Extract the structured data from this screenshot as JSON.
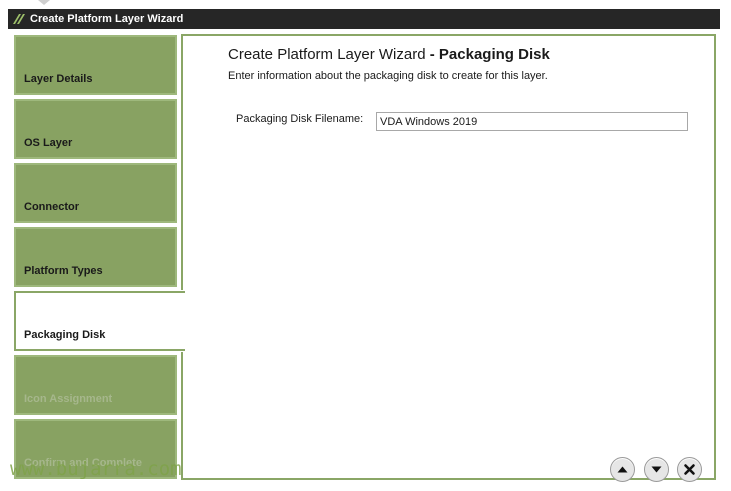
{
  "window": {
    "title": "Create Platform Layer Wizard"
  },
  "sidebar": {
    "items": [
      {
        "label": "Layer Details",
        "state": "enabled"
      },
      {
        "label": "OS Layer",
        "state": "enabled"
      },
      {
        "label": "Connector",
        "state": "enabled"
      },
      {
        "label": "Platform Types",
        "state": "enabled"
      },
      {
        "label": "Packaging Disk",
        "state": "active"
      },
      {
        "label": "Icon Assignment",
        "state": "disabled"
      },
      {
        "label": "Confirm and Complete",
        "state": "disabled"
      }
    ]
  },
  "main": {
    "heading_prefix": "Create Platform Layer Wizard",
    "heading_step": "- Packaging Disk",
    "subtitle": "Enter information about the packaging disk to create for this layer.",
    "field": {
      "label": "Packaging Disk Filename:",
      "value": "VDA Windows 2019"
    }
  },
  "nav": {
    "up_icon": "arrow-up-icon",
    "down_icon": "arrow-down-icon",
    "close_icon": "close-icon"
  },
  "watermark": "www.bujarra.com",
  "colors": {
    "accent": "#88a262",
    "titlebar": "#262626",
    "border": "#8aa666"
  }
}
